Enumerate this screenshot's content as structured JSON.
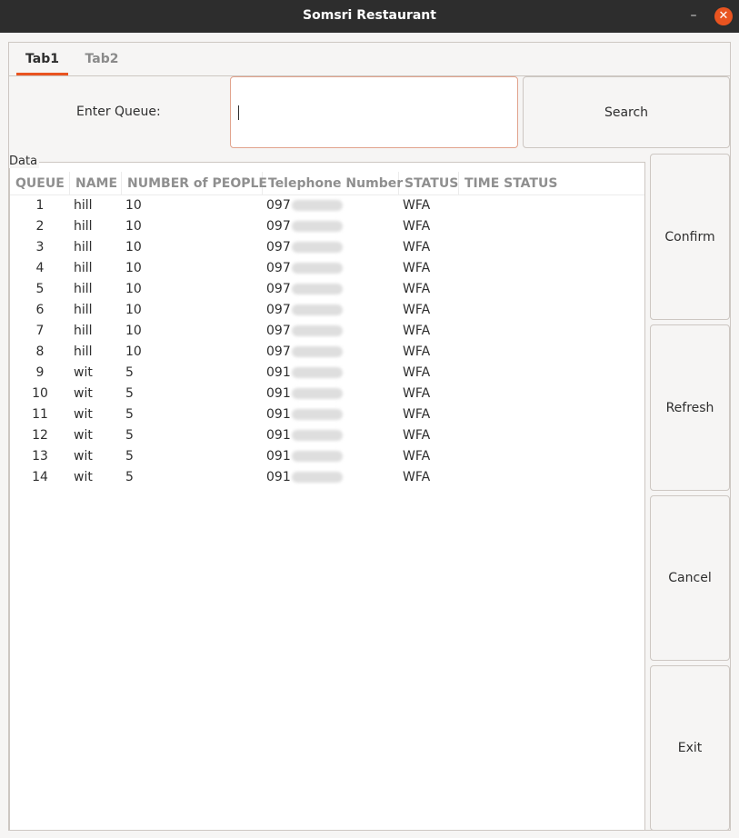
{
  "window": {
    "title": "Somsri Restaurant",
    "minimize_glyph": "–",
    "close_glyph": "✕",
    "close_color": "#e95420"
  },
  "tabs": [
    {
      "label": "Tab1",
      "active": true
    },
    {
      "label": "Tab2",
      "active": false
    }
  ],
  "search": {
    "label": "Enter Queue:",
    "value": "",
    "button_label": "Search"
  },
  "data_group": {
    "label": "Data"
  },
  "table": {
    "columns": [
      "QUEUE",
      "NAME",
      "NUMBER of PEOPLE",
      "Telephone Number",
      "STATUS",
      "TIME STATUS"
    ],
    "rows": [
      {
        "queue": "1",
        "name": "hill",
        "people": "10",
        "tel": "097",
        "status": "WFA",
        "time_status": ""
      },
      {
        "queue": "2",
        "name": "hill",
        "people": "10",
        "tel": "097",
        "status": "WFA",
        "time_status": ""
      },
      {
        "queue": "3",
        "name": "hill",
        "people": "10",
        "tel": "097",
        "status": "WFA",
        "time_status": ""
      },
      {
        "queue": "4",
        "name": "hill",
        "people": "10",
        "tel": "097",
        "status": "WFA",
        "time_status": ""
      },
      {
        "queue": "5",
        "name": "hill",
        "people": "10",
        "tel": "097",
        "status": "WFA",
        "time_status": ""
      },
      {
        "queue": "6",
        "name": "hill",
        "people": "10",
        "tel": "097",
        "status": "WFA",
        "time_status": ""
      },
      {
        "queue": "7",
        "name": "hill",
        "people": "10",
        "tel": "097",
        "status": "WFA",
        "time_status": ""
      },
      {
        "queue": "8",
        "name": "hill",
        "people": "10",
        "tel": "097",
        "status": "WFA",
        "time_status": ""
      },
      {
        "queue": "9",
        "name": "wit",
        "people": "5",
        "tel": "091",
        "status": "WFA",
        "time_status": ""
      },
      {
        "queue": "10",
        "name": "wit",
        "people": "5",
        "tel": "091",
        "status": "WFA",
        "time_status": ""
      },
      {
        "queue": "11",
        "name": "wit",
        "people": "5",
        "tel": "091",
        "status": "WFA",
        "time_status": ""
      },
      {
        "queue": "12",
        "name": "wit",
        "people": "5",
        "tel": "091",
        "status": "WFA",
        "time_status": ""
      },
      {
        "queue": "13",
        "name": "wit",
        "people": "5",
        "tel": "091",
        "status": "WFA",
        "time_status": ""
      },
      {
        "queue": "14",
        "name": "wit",
        "people": "5",
        "tel": "091",
        "status": "WFA",
        "time_status": ""
      }
    ]
  },
  "actions": {
    "confirm": "Confirm",
    "refresh": "Refresh",
    "cancel": "Cancel",
    "exit": "Exit"
  }
}
